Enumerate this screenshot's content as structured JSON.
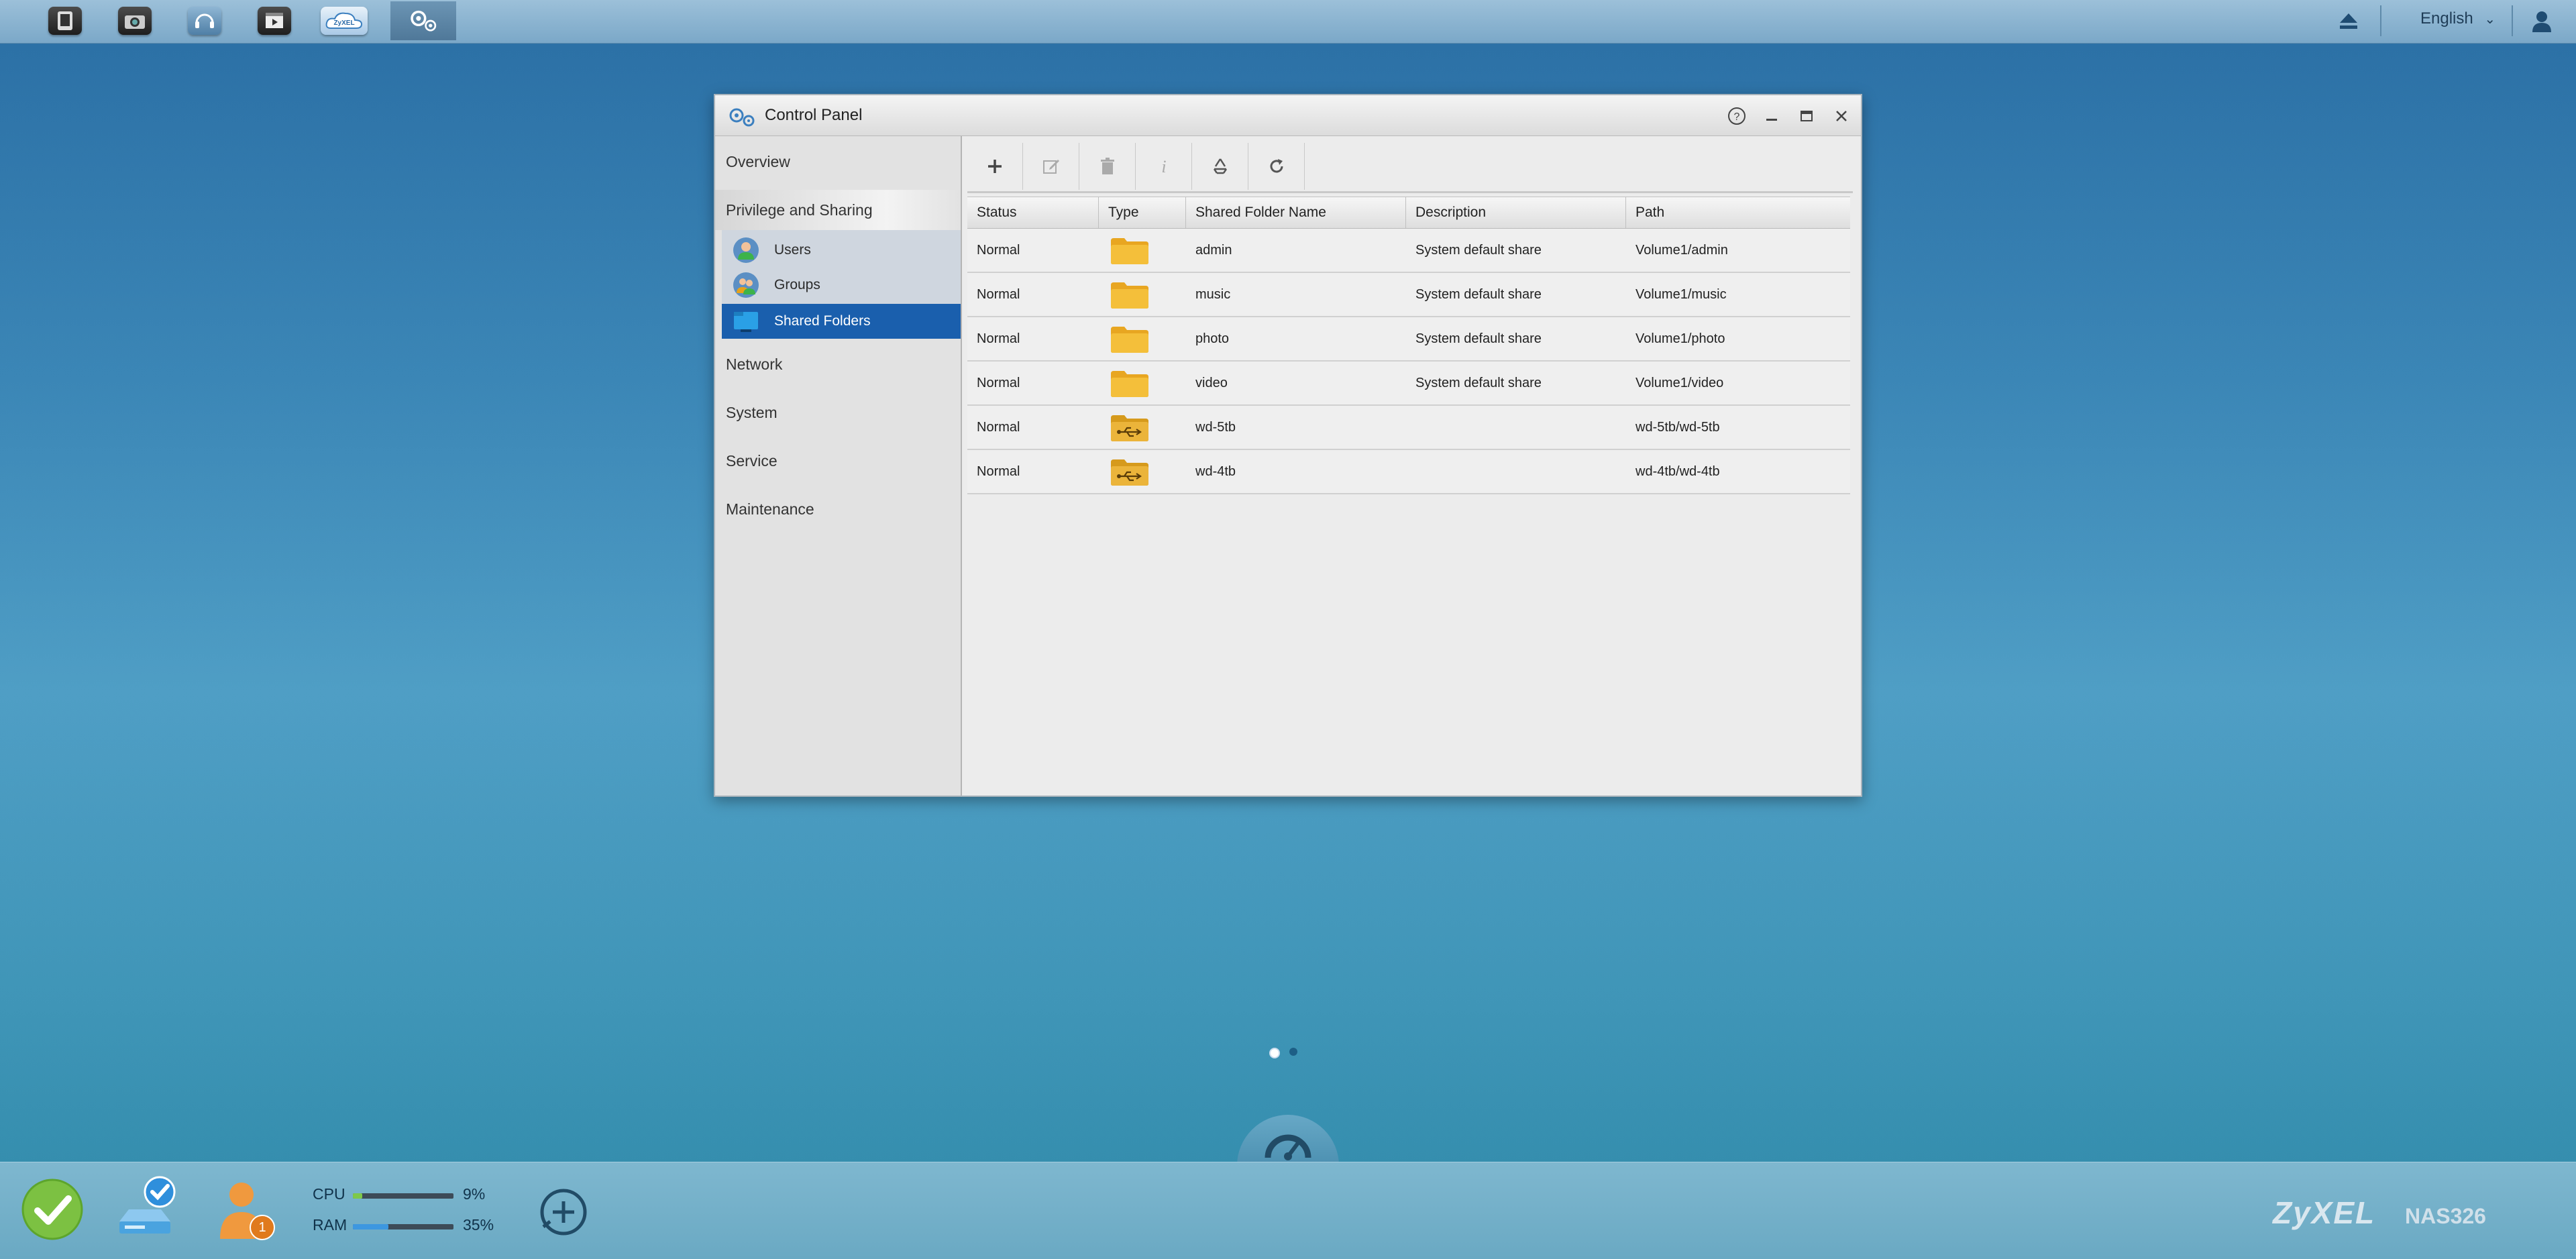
{
  "topbar": {
    "apps": [
      {
        "name": "file-browser-icon",
        "glyph": "▮"
      },
      {
        "name": "photo-app-icon",
        "glyph": "📷"
      },
      {
        "name": "music-app-icon",
        "glyph": "♫"
      },
      {
        "name": "video-app-icon",
        "glyph": "▶"
      },
      {
        "name": "zyxel-cloud-icon",
        "glyph": "☁"
      },
      {
        "name": "control-panel-icon",
        "glyph": "⚙"
      }
    ],
    "language": "English"
  },
  "window": {
    "title": "Control Panel"
  },
  "sidebar": {
    "overview": "Overview",
    "privilege": "Privilege and Sharing",
    "sub_items": [
      {
        "label": "Users"
      },
      {
        "label": "Groups"
      },
      {
        "label": "Shared Folders"
      }
    ],
    "network": "Network",
    "system": "System",
    "service": "Service",
    "maintenance": "Maintenance"
  },
  "toolbar": {
    "buttons": [
      "add",
      "edit",
      "delete",
      "info",
      "recycle-bin",
      "refresh"
    ]
  },
  "table": {
    "columns": [
      "Status",
      "Type",
      "Shared Folder Name",
      "Description",
      "Path"
    ],
    "rows": [
      {
        "status": "Normal",
        "type": "folder",
        "name": "admin",
        "description": "System default share",
        "path": "Volume1/admin"
      },
      {
        "status": "Normal",
        "type": "folder",
        "name": "music",
        "description": "System default share",
        "path": "Volume1/music"
      },
      {
        "status": "Normal",
        "type": "folder",
        "name": "photo",
        "description": "System default share",
        "path": "Volume1/photo"
      },
      {
        "status": "Normal",
        "type": "folder",
        "name": "video",
        "description": "System default share",
        "path": "Volume1/video"
      },
      {
        "status": "Normal",
        "type": "usb-folder",
        "name": "wd-5tb",
        "description": "",
        "path": "wd-5tb/wd-5tb"
      },
      {
        "status": "Normal",
        "type": "usb-folder",
        "name": "wd-4tb",
        "description": "",
        "path": "wd-4tb/wd-4tb"
      }
    ]
  },
  "bottombar": {
    "cpu_label": "CPU",
    "cpu_value": "9%",
    "cpu_fraction": 0.09,
    "ram_label": "RAM",
    "ram_value": "35%",
    "ram_fraction": 0.35,
    "notification_count": "1",
    "brand": "ZyXEL",
    "model": "NAS326"
  },
  "colors": {
    "accent": "#1a5fad",
    "folder": "#e8a621",
    "cpu_bar": "#7ec84a",
    "ram_bar": "#3d97e0"
  }
}
